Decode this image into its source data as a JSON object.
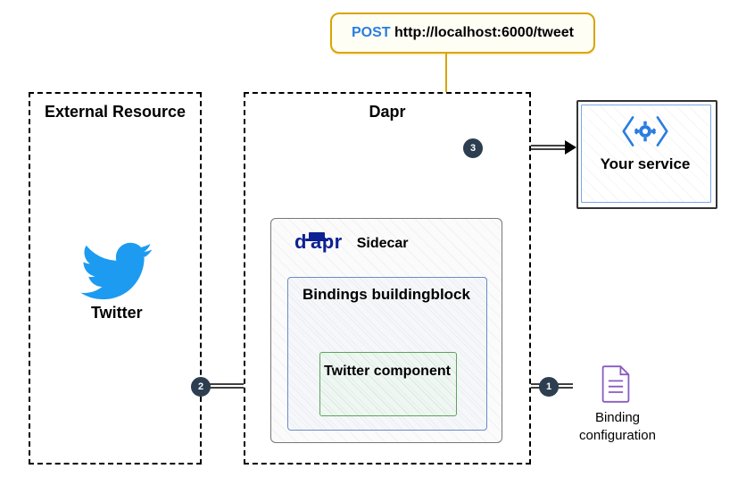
{
  "callout": {
    "method": "POST",
    "url": "http://localhost:6000/tweet"
  },
  "externalResource": {
    "title": "External Resource",
    "item": "Twitter"
  },
  "dapr": {
    "title": "Dapr",
    "sidecar": {
      "label": "Sidecar",
      "logo": "dapr"
    },
    "bindings": {
      "label": "Bindings buildingblock"
    },
    "component": {
      "label": "Twitter component"
    }
  },
  "yourService": {
    "title": "Your service"
  },
  "bindingConfig": {
    "label": "Binding configuration"
  },
  "arrows": {
    "from_config": {
      "badge": "1"
    },
    "from_twitter": {
      "badge": "2"
    },
    "to_service": {
      "badge": "3"
    }
  },
  "colors": {
    "callout_border": "#d9a400",
    "post_blue": "#2a7de1",
    "dapr_navy": "#0d2192",
    "twitter_blue": "#1d9bf0",
    "doc_purple": "#8a5bbf",
    "box_green": "#5aa65a",
    "box_blue": "#6b8cc4",
    "service_blue": "#2a7de1"
  }
}
